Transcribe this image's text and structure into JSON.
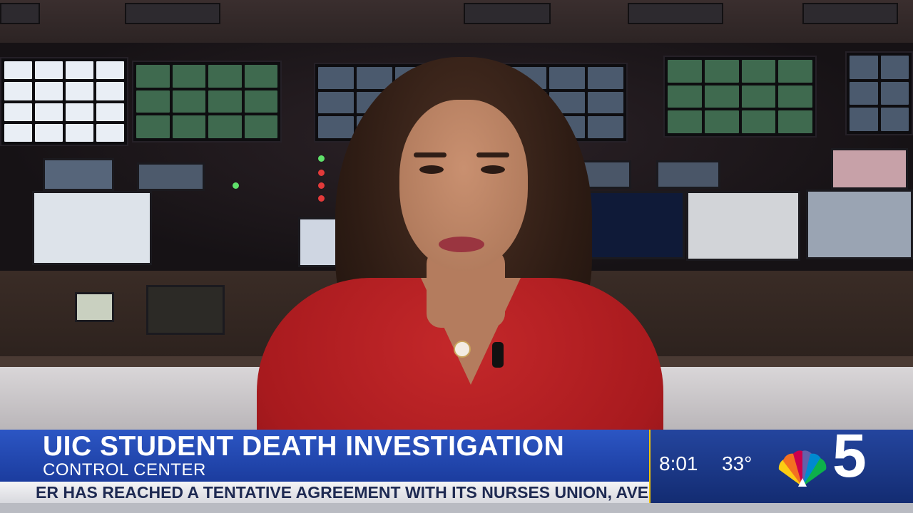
{
  "lower_third": {
    "headline": "UIC STUDENT DEATH INVESTIGATION",
    "subhead": "CONTROL CENTER",
    "ticker": "ER HAS REACHED A TENTATIVE AGREEMENT WITH ITS NURSES UNION, AVERTING A STRIKE"
  },
  "info": {
    "time": "8:01",
    "temperature": "33°",
    "channel": "5",
    "logo": "nbc-peacock-icon"
  },
  "colors": {
    "headline_bar": "#2c56c4",
    "info_box": "#24459e",
    "ticker_bg": "#f4f4f6",
    "ticker_text": "#1e2a52",
    "shirt": "#c4282a"
  }
}
